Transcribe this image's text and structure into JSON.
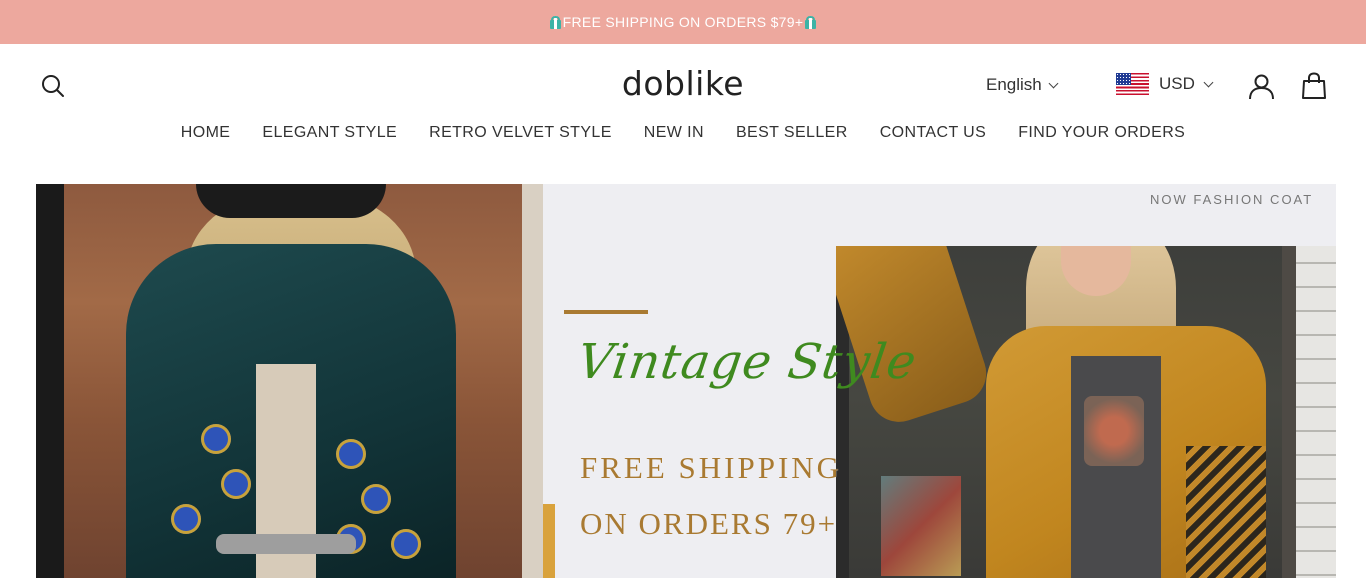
{
  "announcement": {
    "text": "FREE SHIPPING ON ORDERS $79+",
    "icon": "gift-icon"
  },
  "header": {
    "logo": "doblike",
    "language": "English",
    "currency": "USD",
    "currency_flag": "us-flag-icon",
    "icons": [
      "search-icon",
      "user-icon",
      "cart-icon"
    ]
  },
  "nav": {
    "items": [
      {
        "label": "HOME"
      },
      {
        "label": "ELEGANT STYLE"
      },
      {
        "label": "RETRO VELVET STYLE"
      },
      {
        "label": "NEW IN"
      },
      {
        "label": "BEST SELLER"
      },
      {
        "label": "CONTACT US"
      },
      {
        "label": "FIND YOUR ORDERS"
      }
    ]
  },
  "hero": {
    "script_title": "Vintage Style",
    "promo_line1": "FREE SHIPPING",
    "promo_line2": "ON ORDERS 79+",
    "corner_label": "NOW FASHION COAT"
  },
  "colors": {
    "announcement_bg": "#eda89e",
    "script_green": "#3f8a1f",
    "promo_gold": "#a97a32"
  }
}
